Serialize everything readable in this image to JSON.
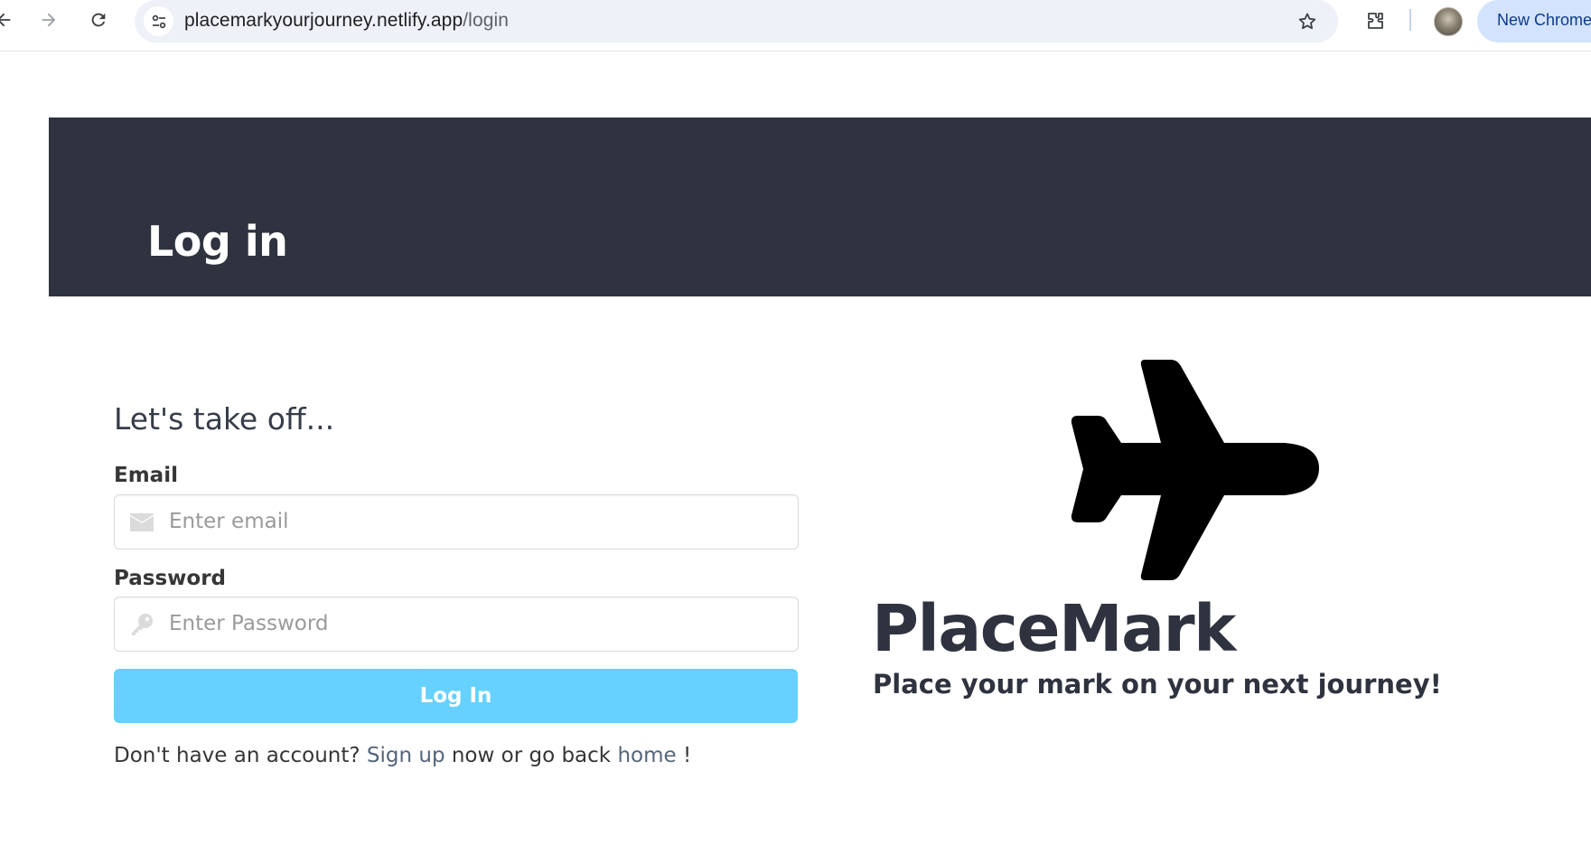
{
  "browser": {
    "url_host": "placemarkyourjourney.netlify.app",
    "url_path": "/login",
    "new_chrome_label": "New Chrome"
  },
  "hero": {
    "title": "Log in"
  },
  "login_form": {
    "subtitle": "Let's take off...",
    "email_label": "Email",
    "email_placeholder": "Enter email",
    "email_value": "",
    "password_label": "Password",
    "password_placeholder": "Enter Password",
    "password_value": "",
    "submit_label": "Log In",
    "footer_prefix": "Don't have an account?",
    "signup_link": "Sign up",
    "footer_middle": "now or go back",
    "home_link": "home",
    "footer_suffix": "!"
  },
  "brand": {
    "name": "PlaceMark",
    "tagline": "Place your mark on your next journey!",
    "icon": "plane-icon"
  },
  "colors": {
    "hero_background": "#2f333f",
    "button_background": "#66d1ff",
    "link_color": "#55657a"
  }
}
